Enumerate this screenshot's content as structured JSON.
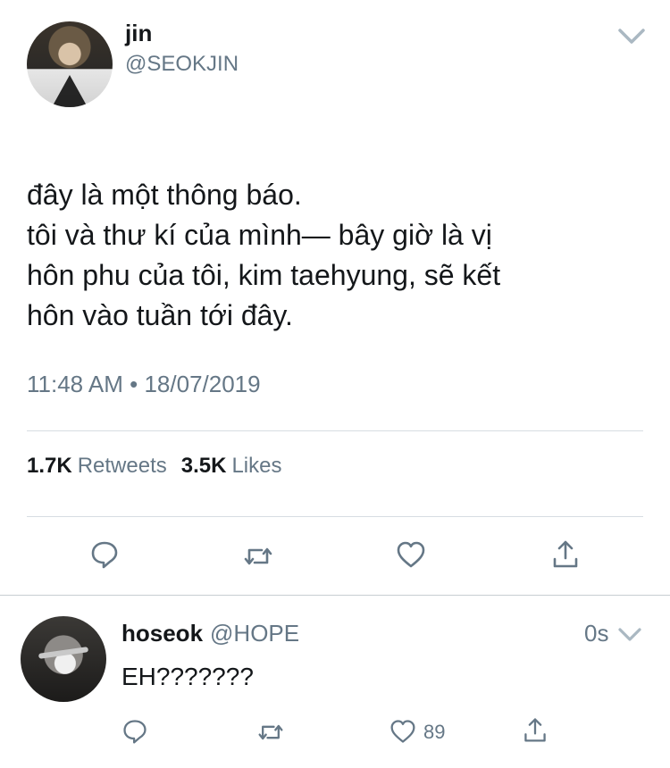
{
  "tweet": {
    "name": "jin",
    "handle": "@SEOKJIN",
    "text_lines": [
      "đây là một thông báo.",
      "tôi và thư kí của mình— bây giờ là vị",
      "hôn phu của tôi, kim taehyung, sẽ kết",
      "hôn vào tuần tới đây."
    ],
    "timestamp": "11:48 AM • 18/07/2019",
    "retweets_count": "1.7K",
    "retweets_label": "Retweets",
    "likes_count": "3.5K",
    "likes_label": "Likes",
    "icons": [
      "reply-icon",
      "retweet-icon",
      "like-icon",
      "share-icon"
    ]
  },
  "reply": {
    "name": "hoseok",
    "handle": "@HOPE",
    "time": "0s",
    "text": "EH???????",
    "like_count": "89",
    "icons": [
      "reply-icon",
      "retweet-icon",
      "like-icon",
      "share-icon"
    ]
  },
  "colors": {
    "text": "#14171a",
    "secondary": "#657786",
    "divider": "#d7dde2"
  }
}
